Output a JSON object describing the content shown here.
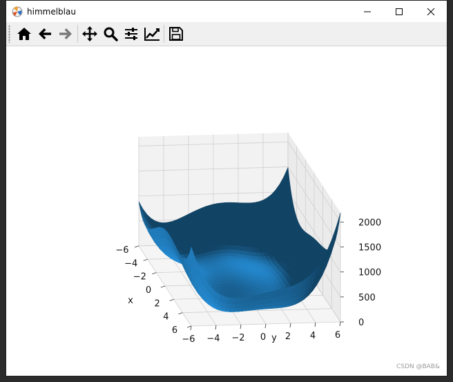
{
  "window": {
    "title": "himmelblau",
    "controls": [
      "minimize",
      "maximize",
      "close"
    ]
  },
  "toolbar": {
    "buttons": [
      {
        "name": "home",
        "icon": "home-icon"
      },
      {
        "name": "back",
        "icon": "arrow-left-icon"
      },
      {
        "name": "forward",
        "icon": "arrow-right-icon"
      },
      {
        "name": "pan",
        "icon": "move-icon"
      },
      {
        "name": "zoom",
        "icon": "magnifier-icon"
      },
      {
        "name": "configure-subplots",
        "icon": "sliders-icon"
      },
      {
        "name": "edit-axes",
        "icon": "line-chart-icon"
      },
      {
        "name": "save",
        "icon": "floppy-disk-icon"
      }
    ]
  },
  "chart_data": {
    "type": "surface",
    "function": "(x^2 + y - 11)^2 + (x + y^2 - 7)^2",
    "title": "",
    "xlabel": "x",
    "ylabel": "y",
    "zlabel": "",
    "x_ticks": [
      "−6",
      "−4",
      "−2",
      "0",
      "2",
      "4",
      "6"
    ],
    "y_ticks": [
      "−6",
      "−4",
      "−2",
      "0",
      "2",
      "4",
      "6"
    ],
    "z_ticks": [
      "0",
      "500",
      "1000",
      "1500",
      "2000"
    ],
    "xlim": [
      -6,
      6
    ],
    "ylim": [
      -6,
      6
    ],
    "zlim": [
      0,
      2186
    ],
    "surface_color": "#1f77b4",
    "grid": true
  },
  "watermark": "CSDN @BAB&"
}
